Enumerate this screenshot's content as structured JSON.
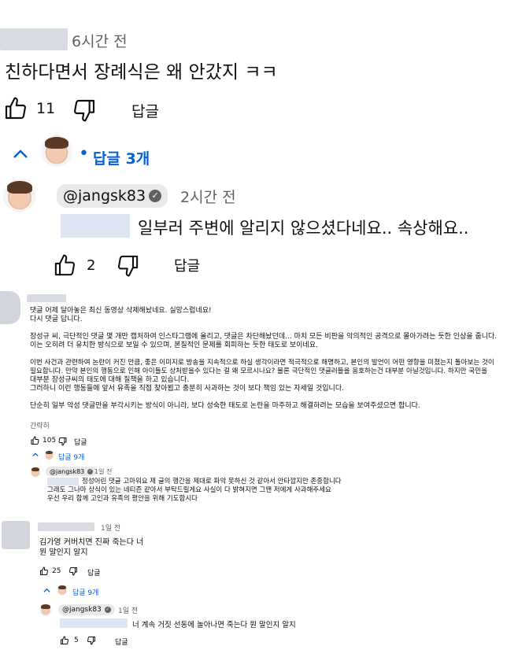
{
  "c1": {
    "time": "6시간 전",
    "text": "친하다면서 장례식은 왜 안갔지 ㅋㅋ",
    "likes": "11",
    "reply_label": "답글",
    "replies_toggle": "답글 3개"
  },
  "r1": {
    "handle": "@jangsk83",
    "time": "2시간 전",
    "text": "일부러 주변에 알리지 않으셨다네요.. 속상해요..",
    "likes": "2",
    "reply_label": "답글"
  },
  "c2": {
    "lines": [
      "댓글 어제 달아놓은 최신 동영상 삭제해놨네요. 실망스럽네요!",
      "다시 댓글 답니다.",
      "",
      "장성규 씨, 극단적인 댓글 몇 개만 캡처하여 인스타그램에 올리고, 댓글은 차단해놨던데... 마치 모든 비판을 악의적인 공격으로 몰아가려는 듯한 인상을 줍니다.",
      "이는 오히려 더 유치한 방식으로 보일 수 있으며, 본질적인 문제를 회피하는 듯한 태도로 보이네요.",
      "",
      "이번 사건과 관련하여 논란이 커진 만큼, 좋은 이미지로 방송을 지속적으로 하실 생각이라면 적극적으로 해명하고, 본인의 발언이 어떤 영향을 미쳤는지 돌아보는 것이",
      "필요합니다. 만약 본인의 행동으로 인해 아이들도 상처받을수 있다는 걸 왜 모르시나요? 물론 극단적인 댓글러들을 옹호하는건 대부분 아닐것입니다. 하지만 국민을",
      "대부분 장성규씨의 태도에 대해 질책을 하고 있습니다.",
      "그러하니 이런 행동들에 앞서 유족을 직접 찾아뵙고 충분히 사과하는 것이 보다 책임 있는 자세일 것입니다.",
      "",
      "단순히 일부 악성 댓글만을 부각시키는 방식이 아니라, 보다 성숙한 태도로 논란을 마주하고 해결하려는 모습을 보여주셨으면 합니다."
    ],
    "more": "간략히",
    "likes": "105",
    "reply_label": "답글",
    "replies_toggle": "답글 9개"
  },
  "r2": {
    "handle": "@jangsk83",
    "time": "1일 전",
    "lines": [
      "정성어린 댓글 고마워요 제 글의 행간을 제대로 파악 못하신 것 같아서 안타깝지만 존중합니다",
      "그래도 그나마 상식이 있는 네티즌 같아서 부탁드릴게요 사실이 다 밝혀지면 그땐 저에게 사과해주세요",
      "우선 우리 함께 고인과 유족의 평안을 위해 기도합시다"
    ]
  },
  "c3": {
    "time": "1일 전",
    "lines": [
      "김가영 커버치면 진짜 죽는다 너",
      "뭔 말인지 알지"
    ],
    "likes": "25",
    "reply_label": "답글",
    "replies_toggle": "답글 9개"
  },
  "r3": {
    "handle": "@jangsk83",
    "time": "1일 전",
    "text": "너 계속 거짓 선동에 놀아나면 죽는다 뭔 말인지 알지",
    "likes": "5",
    "reply_label": "답글"
  },
  "icons": {
    "like": "thumbs-up-icon",
    "dislike": "thumbs-down-icon",
    "chevron": "chevron-up-icon",
    "verified": "verified-check-icon",
    "avatar": "avatar"
  },
  "colors": {
    "link_blue": "#065fd4",
    "text_gray": "#606060",
    "handle_bg": "#e9e9e9"
  }
}
